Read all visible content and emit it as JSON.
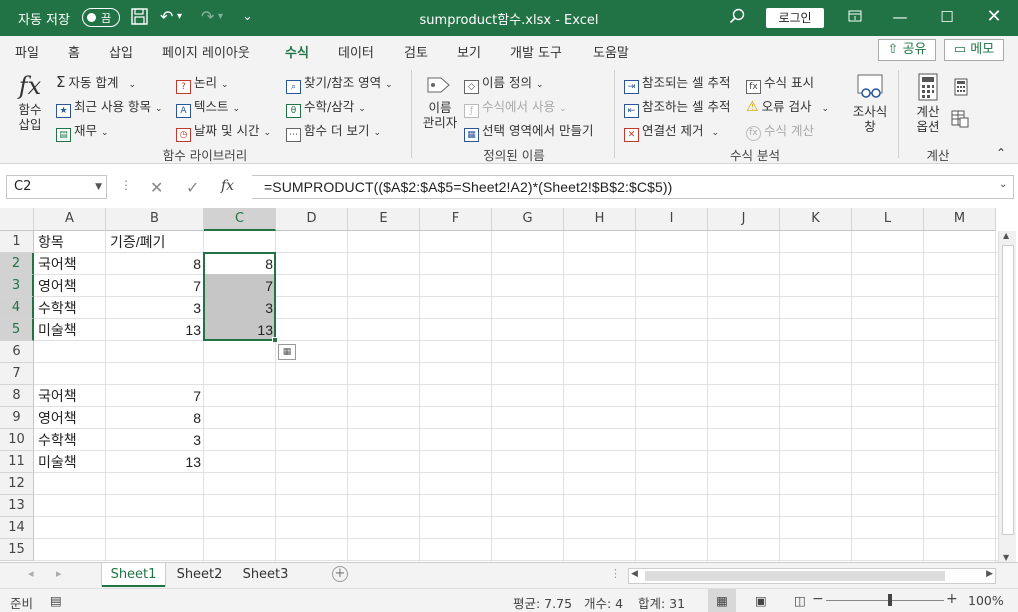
{
  "titlebar": {
    "autosave_label": "자동 저장",
    "autosave_state": "끔",
    "filename": "sumproduct함수.xlsx",
    "separator": "-",
    "app": "Excel",
    "login": "로그인"
  },
  "menu": {
    "tabs": [
      "파일",
      "홈",
      "삽입",
      "페이지 레이아웃",
      "수식",
      "데이터",
      "검토",
      "보기",
      "개발 도구",
      "도움말"
    ],
    "active_tab": "수식",
    "share": "공유",
    "memo": "메모"
  },
  "ribbon": {
    "insert_function": [
      "함수",
      "삽입"
    ],
    "lib": {
      "autosum": "자동 합계",
      "recent": "최근 사용 항목",
      "finance": "재무",
      "logical": "논리",
      "text": "텍스트",
      "datetime": "날짜 및 시간",
      "lookup": "찾기/참조 영역",
      "math": "수학/삼각",
      "more": "함수 더 보기",
      "group": "함수 라이브러리"
    },
    "names": {
      "manager": [
        "이름",
        "관리자"
      ],
      "define": "이름 정의",
      "use_in_formula": "수식에서 사용",
      "create_from_selection": "선택 영역에서 만들기",
      "group": "정의된 이름"
    },
    "audit": {
      "trace_precedents": "참조되는 셀 추적",
      "trace_dependents": "참조하는 셀 추적",
      "remove_arrows": "연결선 제거",
      "show_formulas": "수식 표시",
      "error_check": "오류 검사",
      "evaluate": "수식 계산",
      "watch": [
        "조사식",
        "창"
      ],
      "group": "수식 분석"
    },
    "calc": {
      "options": [
        "계산",
        "옵션"
      ],
      "group": "계산"
    }
  },
  "formula_bar": {
    "name_box": "C2",
    "formula": "=SUMPRODUCT(($A$2:$A$5=Sheet2!A2)*(Sheet2!$B$2:$C$5))",
    "fx": "fx"
  },
  "grid": {
    "columns": [
      "A",
      "B",
      "C",
      "D",
      "E",
      "F",
      "G",
      "H",
      "I",
      "J",
      "K",
      "L",
      "M"
    ],
    "rows": [
      "1",
      "2",
      "3",
      "4",
      "5",
      "6",
      "7",
      "8",
      "9",
      "10",
      "11",
      "12",
      "13",
      "14",
      "15"
    ],
    "selected_column": "C",
    "selected_rows": [
      "2",
      "3",
      "4",
      "5"
    ],
    "cells": [
      {
        "ref": "A1",
        "text": "항목"
      },
      {
        "ref": "B1",
        "text": "기증/폐기"
      },
      {
        "ref": "A2",
        "text": "국어책"
      },
      {
        "ref": "B2",
        "text": "8",
        "num": true
      },
      {
        "ref": "C2",
        "text": "8",
        "num": true
      },
      {
        "ref": "A3",
        "text": "영어책"
      },
      {
        "ref": "B3",
        "text": "7",
        "num": true
      },
      {
        "ref": "C3",
        "text": "7",
        "num": true
      },
      {
        "ref": "A4",
        "text": "수학책"
      },
      {
        "ref": "B4",
        "text": "3",
        "num": true
      },
      {
        "ref": "C4",
        "text": "3",
        "num": true
      },
      {
        "ref": "A5",
        "text": "미술책"
      },
      {
        "ref": "B5",
        "text": "13",
        "num": true
      },
      {
        "ref": "C5",
        "text": "13",
        "num": true
      },
      {
        "ref": "A8",
        "text": "국어책"
      },
      {
        "ref": "B8",
        "text": "7",
        "num": true
      },
      {
        "ref": "A9",
        "text": "영어책"
      },
      {
        "ref": "B9",
        "text": "8",
        "num": true
      },
      {
        "ref": "A10",
        "text": "수학책"
      },
      {
        "ref": "B10",
        "text": "3",
        "num": true
      },
      {
        "ref": "A11",
        "text": "미술책"
      },
      {
        "ref": "B11",
        "text": "13",
        "num": true
      }
    ]
  },
  "sheets": {
    "tabs": [
      "Sheet1",
      "Sheet2",
      "Sheet3"
    ],
    "active": "Sheet1"
  },
  "status": {
    "ready": "준비",
    "average": "평균: 7.75",
    "count": "개수: 4",
    "sum": "합계: 31",
    "zoom": "100%"
  },
  "colors": {
    "accent": "#217346",
    "selection_fill": "#c6c6c6"
  }
}
